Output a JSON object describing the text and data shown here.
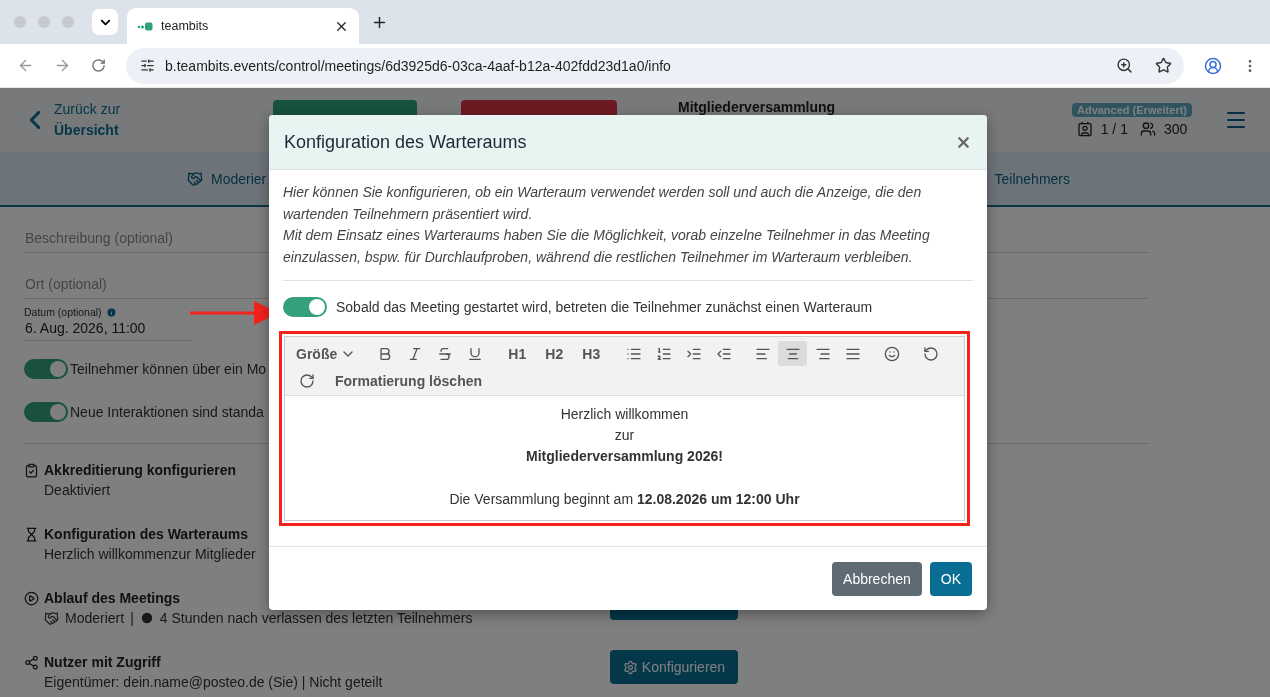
{
  "browser": {
    "tab_title": "teambits",
    "url": "b.teambits.events/control/meetings/6d3925d6-03ca-4aaf-b12a-402fdd23d1a0/info"
  },
  "header": {
    "back_line_1": "Zurück zur",
    "back_line_2": "Übersicht",
    "title": "Mitgliederversammlung",
    "plan_badge": "Advanced (Erweitert)",
    "rooms": "1 / 1",
    "participants": "300"
  },
  "nav": {
    "items": [
      {
        "label": "Moderier",
        "kind": "moderation"
      },
      {
        "label": "Teilnehmers",
        "kind": "plain"
      }
    ]
  },
  "form": {
    "fields": [
      {
        "placeholder": "Beschreibung (optional)"
      },
      {
        "placeholder": "Ort (optional)"
      }
    ],
    "date": {
      "label": "Datum (optional)",
      "value": "6. Aug. 2026, 11:00"
    },
    "toggles": [
      {
        "label": "Teilnehmer können über ein Mo",
        "on": true
      },
      {
        "label": "Neue Interaktionen sind standa",
        "on": true
      }
    ]
  },
  "sections": [
    {
      "kind": "accreditation",
      "title": "Akkreditierung konfigurieren",
      "detail": "Deaktiviert"
    },
    {
      "kind": "waiting_room",
      "title": "Konfiguration des Warteraums",
      "detail": "Herzlich willkommenzur Mitglieder"
    },
    {
      "kind": "flow",
      "title": "Ablauf des Meetings",
      "mode": "Moderiert",
      "separator": "|",
      "timing": "4 Stunden nach verlassen des letzten Teilnehmers",
      "button": {
        "kind": "plain"
      }
    },
    {
      "kind": "access",
      "title": "Nutzer mit Zugriff",
      "detail": "Eigentümer: dein.name@posteo.de (Sie) | Nicht geteilt",
      "button": {
        "kind": "gear",
        "label": "Konfigurieren"
      }
    }
  ],
  "modal": {
    "title": "Konfiguration des Warteraums",
    "intro": [
      "Hier können Sie konfigurieren, ob ein Warteraum verwendet werden soll und auch die Anzeige, die den wartenden Teilnehmern präsentiert wird.",
      "Mit dem Einsatz eines Warteraums haben Sie die Möglichkeit, vorab einzelne Teilnehmer in das Meeting einzulassen, bspw. für Durchlaufproben, während die restlichen Teilnehmer im Warteraum verbleiben."
    ],
    "toggle": {
      "label": "Sobald das Meeting gestartet wird, betreten die Teilnehmer zunächst einen Warteraum",
      "on": true
    },
    "toolbar_rows": [
      [
        {
          "kind": "size",
          "label": "Größe"
        },
        {
          "kind": "bold"
        },
        {
          "kind": "italic"
        },
        {
          "kind": "strike"
        },
        {
          "kind": "underline"
        },
        {
          "kind": "heading",
          "label": "H1"
        },
        {
          "kind": "heading",
          "label": "H2"
        },
        {
          "kind": "heading",
          "label": "H3"
        },
        {
          "kind": "bullets"
        },
        {
          "kind": "numbers"
        },
        {
          "kind": "indent"
        },
        {
          "kind": "outdent"
        },
        {
          "kind": "align_left",
          "selected": false
        },
        {
          "kind": "align_center",
          "selected": true
        },
        {
          "kind": "align_right",
          "selected": false
        },
        {
          "kind": "align_justify",
          "selected": false
        },
        {
          "kind": "emoji"
        },
        {
          "kind": "undo"
        }
      ],
      [
        {
          "kind": "redo"
        },
        {
          "kind": "clear",
          "label": "Formatierung löschen"
        }
      ]
    ],
    "content": [
      {
        "text": "Herzlich willkommen",
        "bold": false,
        "spaced": false
      },
      {
        "text": "zur",
        "bold": false,
        "spaced": false
      },
      {
        "text": "Mitgliederversammlung 2026!",
        "bold": true,
        "spaced": false
      },
      {
        "text": "Die Versammlung beginnt am **12.08.2026 um 12:00 Uhr**",
        "bold": false,
        "spaced": true
      }
    ],
    "buttons": [
      {
        "label": "Abbrechen",
        "kind": "secondary"
      },
      {
        "label": "OK",
        "kind": "primary"
      }
    ]
  },
  "annotations": {
    "arrow": true,
    "editor_highlight": true
  }
}
